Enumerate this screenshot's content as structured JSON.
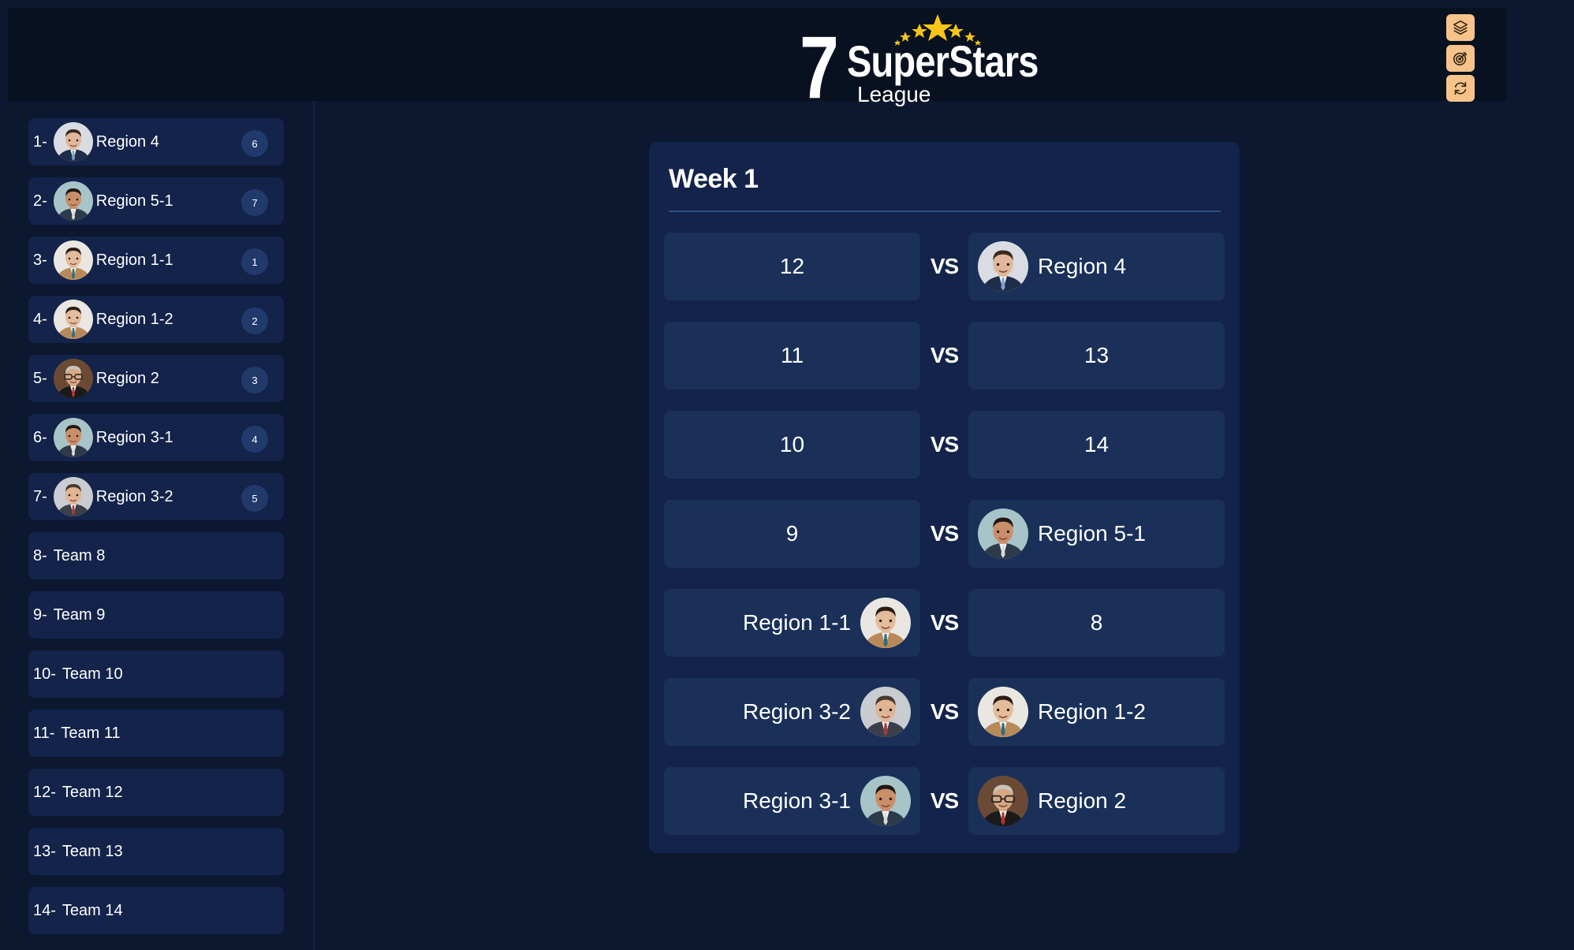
{
  "header": {
    "logo": {
      "number": "7",
      "title": "SuperStars",
      "subtitle": "League"
    },
    "tools": [
      {
        "icon": "layers-icon"
      },
      {
        "icon": "target-icon"
      },
      {
        "icon": "refresh-icon"
      }
    ],
    "accent_color": "#f7c38a"
  },
  "standings": [
    {
      "rank": "1-",
      "name": "Region 4",
      "badge": "6",
      "avatar": "man-suit-blue"
    },
    {
      "rank": "2-",
      "name": "Region 5-1",
      "badge": "7",
      "avatar": "man-smile"
    },
    {
      "rank": "3-",
      "name": "Region 1-1",
      "badge": "1",
      "avatar": "man-tan-jacket"
    },
    {
      "rank": "4-",
      "name": "Region 1-2",
      "badge": "2",
      "avatar": "man-tan-jacket"
    },
    {
      "rank": "5-",
      "name": "Region 2",
      "badge": "3",
      "avatar": "man-glasses"
    },
    {
      "rank": "6-",
      "name": "Region 3-1",
      "badge": "4",
      "avatar": "man-smile"
    },
    {
      "rank": "7-",
      "name": "Region 3-2",
      "badge": "5",
      "avatar": "man-suit-red"
    },
    {
      "rank": "8-",
      "name": "Team 8"
    },
    {
      "rank": "9-",
      "name": "Team 9"
    },
    {
      "rank": "10-",
      "name": "Team 10"
    },
    {
      "rank": "11-",
      "name": "Team 11"
    },
    {
      "rank": "12-",
      "name": "Team 12"
    },
    {
      "rank": "13-",
      "name": "Team 13"
    },
    {
      "rank": "14-",
      "name": "Team 14"
    }
  ],
  "week": {
    "title": "Week 1",
    "vs_label": "VS",
    "matches": [
      {
        "home": "12",
        "away": "Region 4"
      },
      {
        "home": "11",
        "away": "13"
      },
      {
        "home": "10",
        "away": "14"
      },
      {
        "home": "9",
        "away": "Region 5-1"
      },
      {
        "home": "Region 1-1",
        "away": "8"
      },
      {
        "home": "Region 3-2",
        "away": "Region 1-2"
      },
      {
        "home": "Region 3-1",
        "away": "Region 2"
      }
    ]
  }
}
